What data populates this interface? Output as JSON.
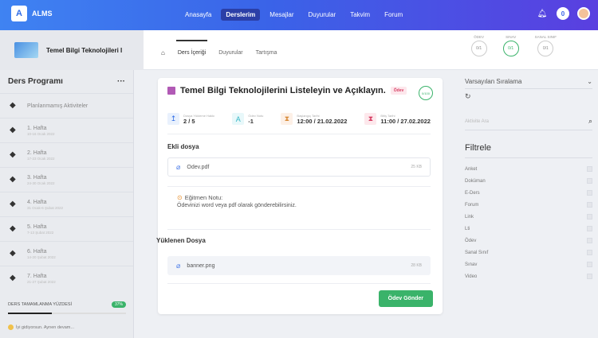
{
  "topbar": {
    "logo_letter": "A",
    "app_name": "ALMS",
    "nav": [
      "Anasayfa",
      "Derslerim",
      "Mesajlar",
      "Duyurular",
      "Takvim",
      "Forum"
    ],
    "active_nav": "Derslerim",
    "notification_count": "0"
  },
  "course": {
    "title": "Temel Bilgi Teknolojileri I",
    "tabs": [
      "Ders İçeriği",
      "Duyurular",
      "Tartışma"
    ]
  },
  "stats": [
    {
      "label": "ÖDEV",
      "value": "0/1"
    },
    {
      "label": "SINAV",
      "value": "0/1"
    },
    {
      "label": "SANAL SINIF",
      "value": "0/1"
    }
  ],
  "sidebar": {
    "title": "Ders Programı",
    "more": "···",
    "items": [
      {
        "title": "Planlanmamış Aktiviteler",
        "sub": ""
      },
      {
        "title": "1. Hafta",
        "sub": "10-16 Ocak 2022"
      },
      {
        "title": "2. Hafta",
        "sub": "17-23 Ocak 2022"
      },
      {
        "title": "3. Hafta",
        "sub": "24-30 Ocak 2022"
      },
      {
        "title": "4. Hafta",
        "sub": "31 Ocak-6 Şubat 2022"
      },
      {
        "title": "5. Hafta",
        "sub": "7-13 Şubat 2022"
      },
      {
        "title": "6. Hafta",
        "sub": "14-20 Şubat 2022"
      },
      {
        "title": "7. Hafta",
        "sub": "21-27 Şubat 2022"
      }
    ],
    "progress_label": "DERS TAMAMLANMA YÜZDESİ",
    "progress_value": "37%",
    "progress_fraction": 0.37,
    "note": "İyi gidiyorsun. Aynen devam..."
  },
  "assignment": {
    "title": "Temel Bilgi Teknolojilerini Listeleyin ve Açıklayın.",
    "badge": "Ödev",
    "donut": "0/100",
    "metrics": [
      {
        "label": "Dosya Yükleme Hakkı",
        "value": "2 / 5"
      },
      {
        "label": "Ödev Notu",
        "value": "-1"
      },
      {
        "label": "Başlangıç Tarihi",
        "value": "12:00 / 21.02.2022"
      },
      {
        "label": "Bitiş Tarihi",
        "value": "11:00 / 27.02.2022"
      }
    ],
    "attached_title": "Ekli dosya",
    "attached_file": {
      "name": "Odev.pdf",
      "size": "25 KB"
    },
    "note_title": "Eğitmen Notu:",
    "note_text": "Ödevinizi word veya pdf olarak gönderebilirsiniz.",
    "uploaded_title": "Yüklenen Dosya",
    "uploaded_file": {
      "name": "banner.png",
      "size": "28 KB"
    },
    "send_label": "Ödev Gönder"
  },
  "right": {
    "sort_label": "Varsayılan Sıralama",
    "search_placeholder": "Aktivite Ara",
    "filter_title": "Filtrele",
    "filters": [
      "Anket",
      "Doküman",
      "E-Ders",
      "Forum",
      "Link",
      "Lti",
      "Ödev",
      "Sanal Sınıf",
      "Sınav",
      "Video"
    ]
  }
}
